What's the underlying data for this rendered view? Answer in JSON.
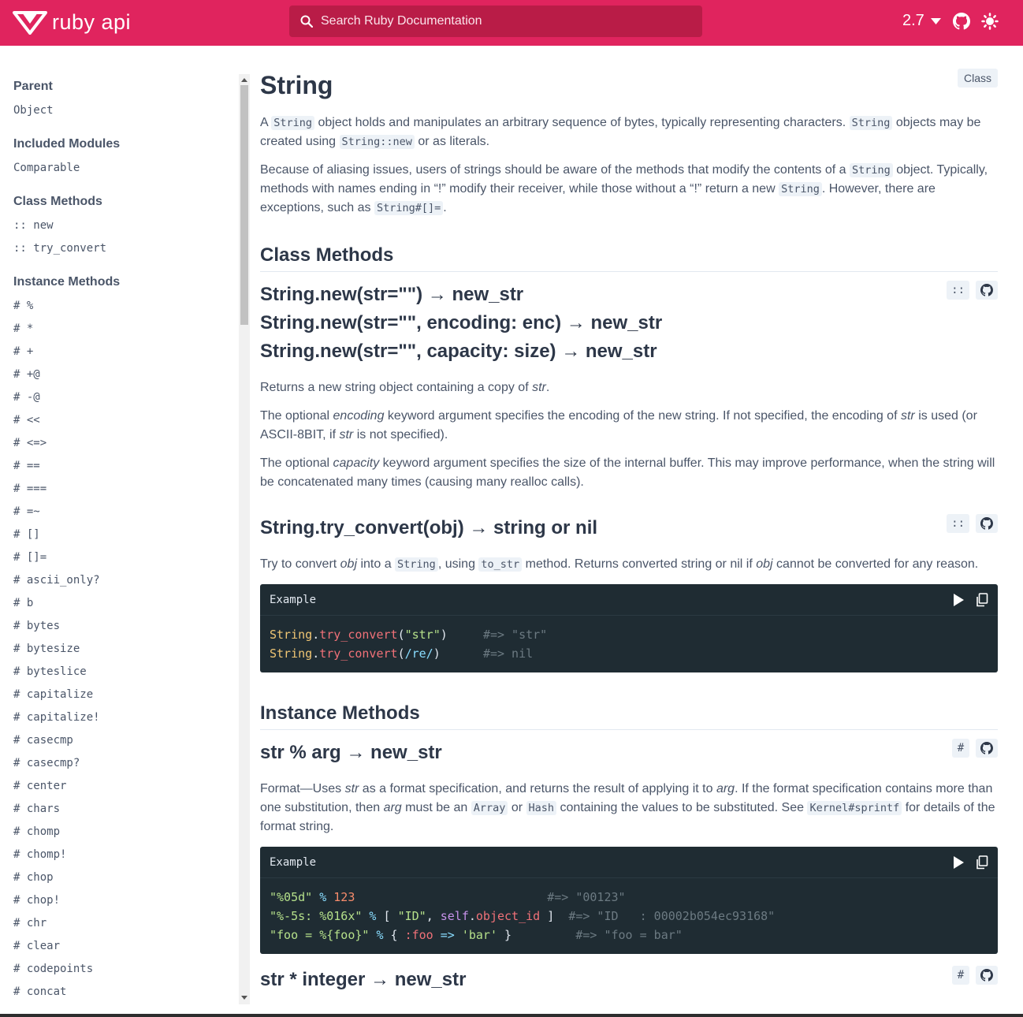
{
  "header": {
    "logo_text": "ruby api",
    "search_placeholder": "Search Ruby Documentation",
    "version": "2.7",
    "brand_color": "#e0245e",
    "icons": [
      "search-icon",
      "chevron-down-icon",
      "github-icon",
      "theme-sun-icon"
    ]
  },
  "sidebar": {
    "parent_heading": "Parent",
    "parent": "Object",
    "included_heading": "Included Modules",
    "included": [
      "Comparable"
    ],
    "class_methods_heading": "Class Methods",
    "class_methods": [
      ":: new",
      ":: try_convert"
    ],
    "instance_methods_heading": "Instance Methods",
    "instance_methods": [
      "# %",
      "# *",
      "# +",
      "# +@",
      "# -@",
      "# <<",
      "# <=>",
      "# ==",
      "# ===",
      "# =~",
      "# []",
      "# []=",
      "# ascii_only?",
      "# b",
      "# bytes",
      "# bytesize",
      "# byteslice",
      "# capitalize",
      "# capitalize!",
      "# casecmp",
      "# casecmp?",
      "# center",
      "# chars",
      "# chomp",
      "# chomp!",
      "# chop",
      "# chop!",
      "# chr",
      "# clear",
      "# codepoints",
      "# concat"
    ]
  },
  "main": {
    "title": "String",
    "kind_badge": "Class",
    "intro": {
      "p1_a": "A ",
      "p1_code1": "String",
      "p1_b": " object holds and manipulates an arbitrary sequence of bytes, typically representing characters. ",
      "p1_code2": "String",
      "p1_c": " objects may be created using ",
      "p1_code3": "String::new",
      "p1_d": " or as literals.",
      "p2_a": "Because of aliasing issues, users of strings should be aware of the methods that modify the contents of a ",
      "p2_code1": "String",
      "p2_b": " object. Typically, methods with names ending in “!” modify their receiver, while those without a “!” return a new ",
      "p2_code2": "String",
      "p2_c": ". However, there are exceptions, such as ",
      "p2_code3": "String#[]=",
      "p2_d": "."
    },
    "class_methods_title": "Class Methods",
    "method_new": {
      "sig1": "String.new(str=\"\") → new_str",
      "sig2": "String.new(str=\"\", encoding: enc) → new_str",
      "sig3": "String.new(str=\"\", capacity: size) → new_str",
      "badge": "::",
      "d1_a": "Returns a new string object containing a copy of ",
      "d1_em": "str",
      "d1_b": ".",
      "d2_a": "The optional ",
      "d2_em1": "encoding",
      "d2_b": " keyword argument specifies the encoding of the new string. If not specified, the encoding of ",
      "d2_em2": "str",
      "d2_c": " is used (or ASCII-8BIT, if ",
      "d2_em3": "str",
      "d2_d": " is not specified).",
      "d3_a": "The optional ",
      "d3_em": "capacity",
      "d3_b": " keyword argument specifies the size of the internal buffer. This may improve performance, when the string will be concatenated many times (causing many realloc calls)."
    },
    "method_try_convert": {
      "sig": "String.try_convert(obj) → string or nil",
      "badge": "::",
      "d_a": "Try to convert ",
      "d_em1": "obj",
      "d_b": " into a ",
      "d_code1": "String",
      "d_c": ", using ",
      "d_code2": "to_str",
      "d_d": " method. Returns converted string or nil if ",
      "d_em2": "obj",
      "d_e": " cannot be converted for any reason.",
      "example_label": "Example",
      "code": {
        "l1_const": "String",
        "l1_dot": ".",
        "l1_meth": "try_convert",
        "l1_p1": "(",
        "l1_str": "\"str\"",
        "l1_p2": ")",
        "l1_pad": "     ",
        "l1_com": "#=> \"str\"",
        "l2_const": "String",
        "l2_dot": ".",
        "l2_meth": "try_convert",
        "l2_p1": "(",
        "l2_re": "/re/",
        "l2_p2": ")",
        "l2_pad": "      ",
        "l2_com": "#=> nil"
      }
    },
    "instance_methods_title": "Instance Methods",
    "method_percent": {
      "sig": "str % arg → new_str",
      "badge": "#",
      "d_a": "Format—Uses ",
      "d_em1": "str",
      "d_b": " as a format specification, and returns the result of applying it to ",
      "d_em2": "arg",
      "d_c": ". If the format specification contains more than one substitution, then ",
      "d_em3": "arg",
      "d_d": " must be an ",
      "d_code1": "Array",
      "d_e": " or ",
      "d_code2": "Hash",
      "d_f": " containing the values to be substituted. See ",
      "d_code3": "Kernel#sprintf",
      "d_g": " for details of the format string.",
      "example_label": "Example",
      "code": {
        "l1_str": "\"%05d\"",
        "l1_op": " % ",
        "l1_num": "123",
        "l1_pad": "                           ",
        "l1_com": "#=> \"00123\"",
        "l2_str": "\"%-5s: %016x\"",
        "l2_op": " % ",
        "l2_b1": "[ ",
        "l2_s2": "\"ID\"",
        "l2_c": ", ",
        "l2_kw": "self",
        "l2_dot": ".",
        "l2_meth": "object_id",
        "l2_b2": " ]",
        "l2_pad": "  ",
        "l2_com": "#=> \"ID   : 00002b054ec93168\"",
        "l3_str": "\"foo = %{foo}\"",
        "l3_op": " % ",
        "l3_b1": "{ ",
        "l3_sym": ":foo",
        "l3_arrow": " => ",
        "l3_s2": "'bar'",
        "l3_b2": " }",
        "l3_pad": "         ",
        "l3_com": "#=> \"foo = bar\""
      }
    },
    "method_star": {
      "sig": "str * integer → new_str",
      "badge": "#"
    }
  }
}
